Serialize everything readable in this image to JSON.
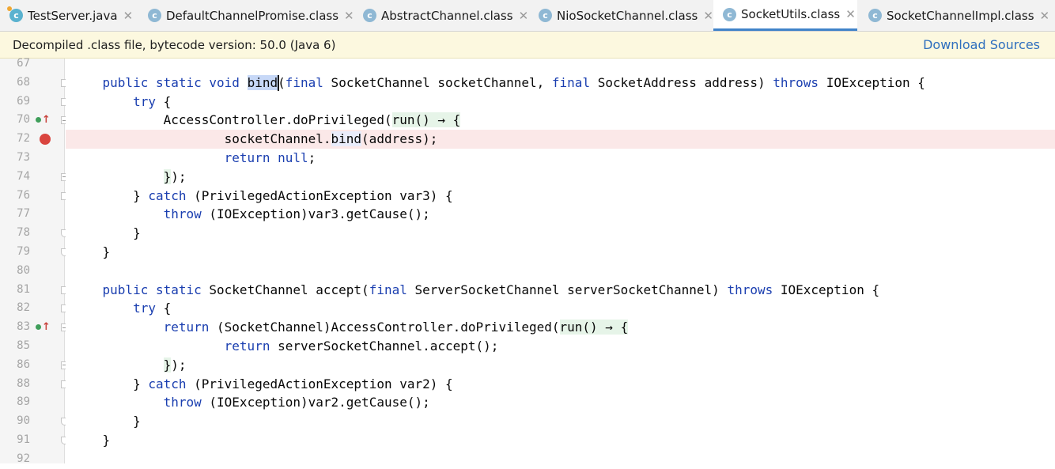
{
  "tabs": [
    {
      "label": "TestServer.java",
      "icon": "class-source-icon",
      "active": false,
      "closable": true
    },
    {
      "label": "DefaultChannelPromise.class",
      "icon": "class-file-icon",
      "active": false,
      "closable": true
    },
    {
      "label": "AbstractChannel.class",
      "icon": "class-file-icon",
      "active": false,
      "closable": true
    },
    {
      "label": "NioSocketChannel.class",
      "icon": "class-file-icon",
      "active": false,
      "closable": true
    },
    {
      "label": "SocketUtils.class",
      "icon": "class-file-icon",
      "active": true,
      "closable": true
    },
    {
      "label": "SocketChannelImpl.class",
      "icon": "class-file-icon",
      "active": false,
      "closable": true
    }
  ],
  "banner": {
    "text": "Decompiled .class file, bytecode version: 50.0 (Java 6)",
    "action": "Download Sources"
  },
  "editor": {
    "lines": [
      {
        "num": "67",
        "fold": "",
        "marker": "",
        "tokens": []
      },
      {
        "num": "68",
        "fold": "open",
        "marker": "",
        "tokens": [
          {
            "t": "    "
          },
          {
            "t": "public",
            "c": "kw"
          },
          {
            "t": " "
          },
          {
            "t": "static",
            "c": "kw"
          },
          {
            "t": " "
          },
          {
            "t": "void",
            "c": "kw"
          },
          {
            "t": " "
          },
          {
            "t": "bind",
            "c": "hl-decl"
          },
          {
            "t": "("
          },
          {
            "t": "final",
            "c": "kw"
          },
          {
            "t": " SocketChannel socketChannel, "
          },
          {
            "t": "final",
            "c": "kw"
          },
          {
            "t": " SocketAddress address) "
          },
          {
            "t": "throws",
            "c": "kw"
          },
          {
            "t": " IOException {"
          }
        ]
      },
      {
        "num": "69",
        "fold": "open",
        "marker": "",
        "tokens": [
          {
            "t": "        "
          },
          {
            "t": "try",
            "c": "kw"
          },
          {
            "t": " {"
          }
        ]
      },
      {
        "num": "70",
        "fold": "plus",
        "marker": "impl",
        "tokens": [
          {
            "t": "            AccessController.doPrivileged("
          },
          {
            "t": "run() → {",
            "c": "hl-lambda"
          }
        ]
      },
      {
        "num": "72",
        "fold": "",
        "marker": "breakpoint",
        "tokens": [
          {
            "t": "                    socketChannel."
          },
          {
            "t": "bind",
            "c": "hl-usage"
          },
          {
            "t": "(address);"
          }
        ]
      },
      {
        "num": "73",
        "fold": "",
        "marker": "",
        "tokens": [
          {
            "t": "                    "
          },
          {
            "t": "return",
            "c": "kw"
          },
          {
            "t": " "
          },
          {
            "t": "null",
            "c": "kw"
          },
          {
            "t": ";"
          }
        ]
      },
      {
        "num": "74",
        "fold": "plus",
        "marker": "",
        "tokens": [
          {
            "t": "            "
          },
          {
            "t": "}",
            "c": "hl-lambda"
          },
          {
            "t": ");"
          }
        ]
      },
      {
        "num": "76",
        "fold": "open",
        "marker": "",
        "tokens": [
          {
            "t": "        } "
          },
          {
            "t": "catch",
            "c": "kw"
          },
          {
            "t": " (PrivilegedActionException var3) {"
          }
        ]
      },
      {
        "num": "77",
        "fold": "",
        "marker": "",
        "tokens": [
          {
            "t": "            "
          },
          {
            "t": "throw",
            "c": "kw"
          },
          {
            "t": " (IOException)var3.getCause();"
          }
        ]
      },
      {
        "num": "78",
        "fold": "end",
        "marker": "",
        "tokens": [
          {
            "t": "        }"
          }
        ]
      },
      {
        "num": "79",
        "fold": "end",
        "marker": "",
        "tokens": [
          {
            "t": "    }"
          }
        ]
      },
      {
        "num": "80",
        "fold": "",
        "marker": "",
        "tokens": []
      },
      {
        "num": "81",
        "fold": "open",
        "marker": "",
        "tokens": [
          {
            "t": "    "
          },
          {
            "t": "public",
            "c": "kw"
          },
          {
            "t": " "
          },
          {
            "t": "static",
            "c": "kw"
          },
          {
            "t": " SocketChannel accept("
          },
          {
            "t": "final",
            "c": "kw"
          },
          {
            "t": " ServerSocketChannel serverSocketChannel) "
          },
          {
            "t": "throws",
            "c": "kw"
          },
          {
            "t": " IOException {"
          }
        ]
      },
      {
        "num": "82",
        "fold": "open",
        "marker": "",
        "tokens": [
          {
            "t": "        "
          },
          {
            "t": "try",
            "c": "kw"
          },
          {
            "t": " {"
          }
        ]
      },
      {
        "num": "83",
        "fold": "plus",
        "marker": "impl",
        "tokens": [
          {
            "t": "            "
          },
          {
            "t": "return",
            "c": "kw"
          },
          {
            "t": " (SocketChannel)AccessController.doPrivileged("
          },
          {
            "t": "run() → {",
            "c": "hl-lambda"
          }
        ]
      },
      {
        "num": "85",
        "fold": "",
        "marker": "",
        "tokens": [
          {
            "t": "                    "
          },
          {
            "t": "return",
            "c": "kw"
          },
          {
            "t": " serverSocketChannel.accept();"
          }
        ]
      },
      {
        "num": "86",
        "fold": "plus",
        "marker": "",
        "tokens": [
          {
            "t": "            "
          },
          {
            "t": "}",
            "c": "hl-lambda"
          },
          {
            "t": ");"
          }
        ]
      },
      {
        "num": "88",
        "fold": "open",
        "marker": "",
        "tokens": [
          {
            "t": "        } "
          },
          {
            "t": "catch",
            "c": "kw"
          },
          {
            "t": " (PrivilegedActionException var2) {"
          }
        ]
      },
      {
        "num": "89",
        "fold": "",
        "marker": "",
        "tokens": [
          {
            "t": "            "
          },
          {
            "t": "throw",
            "c": "kw"
          },
          {
            "t": " (IOException)var2.getCause();"
          }
        ]
      },
      {
        "num": "90",
        "fold": "end",
        "marker": "",
        "tokens": [
          {
            "t": "        }"
          }
        ]
      },
      {
        "num": "91",
        "fold": "end",
        "marker": "",
        "tokens": [
          {
            "t": "    }"
          }
        ]
      },
      {
        "num": "92",
        "fold": "",
        "marker": "",
        "tokens": []
      }
    ]
  },
  "colors": {
    "keyword": "#1b3fb0",
    "breakpoint": "#d9443e",
    "breakpoint_line_bg": "#fbe8e8",
    "banner_bg": "#fcf8df",
    "link": "#2f6fbe",
    "active_tab_underline": "#4083c9"
  }
}
